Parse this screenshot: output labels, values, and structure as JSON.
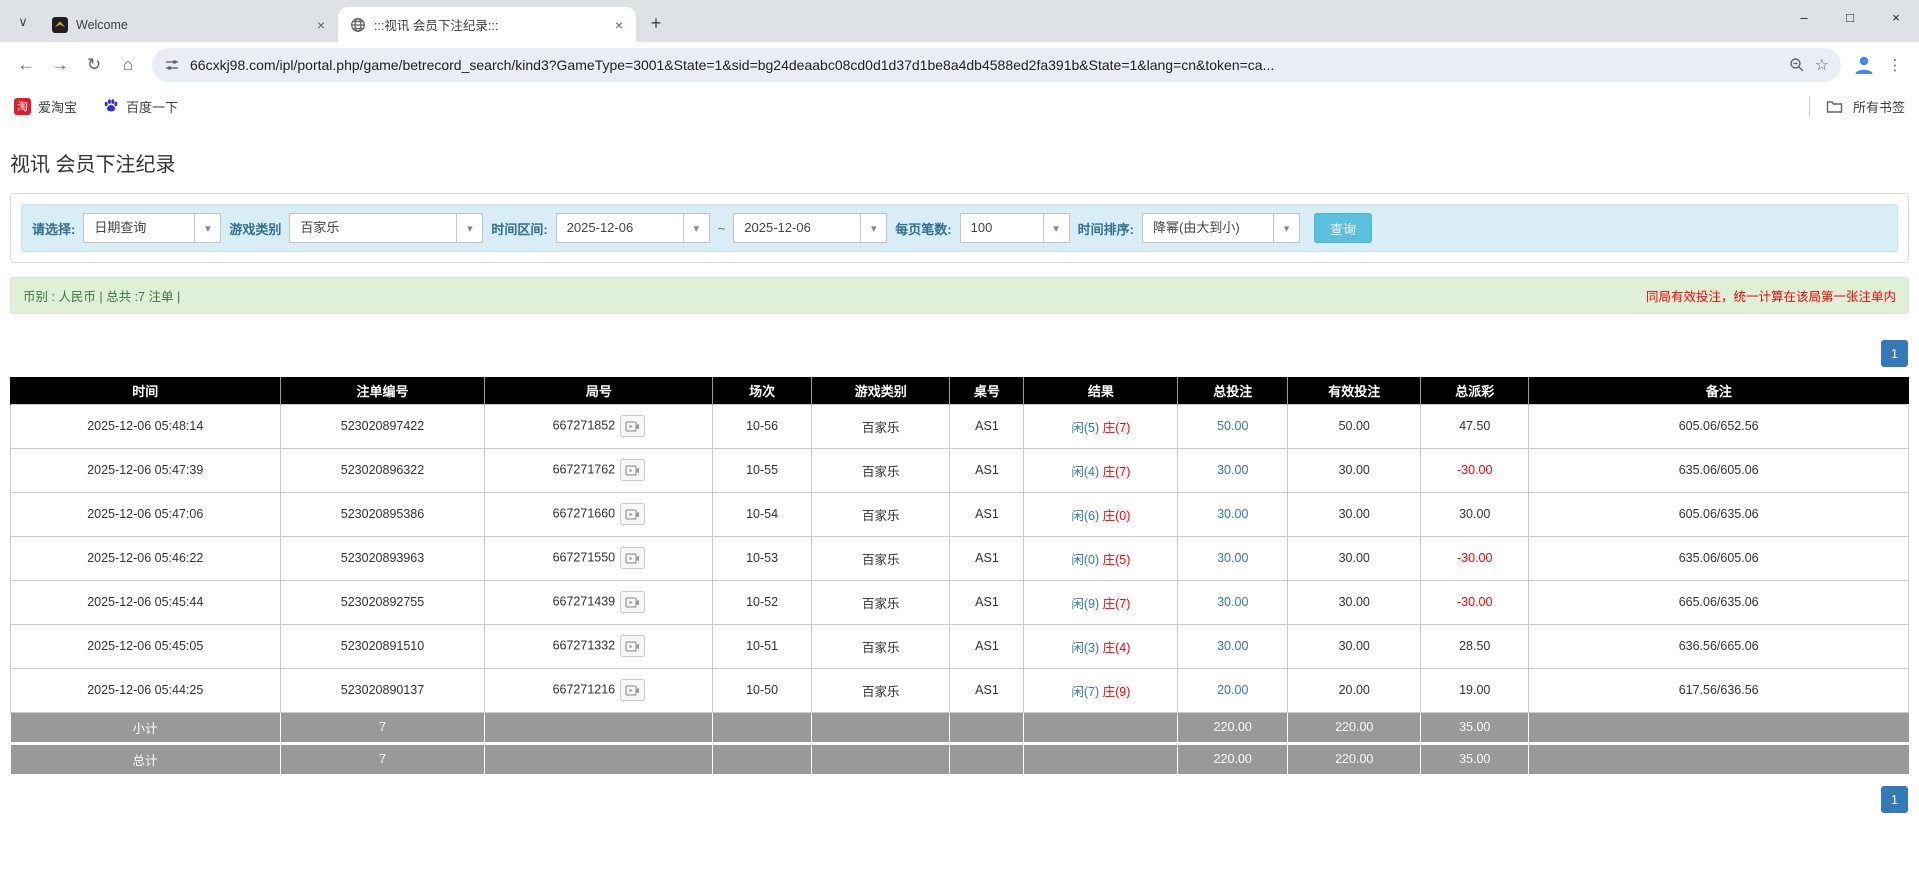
{
  "browser": {
    "tabs": [
      {
        "title": "Welcome"
      },
      {
        "title": ":::视讯 会员下注纪录:::"
      }
    ],
    "url": "66cxkj98.com/ipl/portal.php/game/betrecord_search/kind3?GameType=3001&State=1&sid=bg24deaabc08cd0d1d37d1be8a4db4588ed2fa391b&State=1&lang=cn&token=ca...",
    "bookmarks": [
      {
        "label": "爱淘宝",
        "icon_label": "淘"
      },
      {
        "label": "百度一下"
      }
    ],
    "all_bookmarks_label": "所有书签"
  },
  "icons": {
    "tab_chevron": "∨",
    "close": "×",
    "plus": "+",
    "minimize": "–",
    "maximize": "□",
    "back": "←",
    "forward": "→",
    "reload": "↻",
    "home": "⌂",
    "star": "☆",
    "menu": "⋮",
    "arrow_down": "▾"
  },
  "page": {
    "title": "视讯 会员下注纪录",
    "filters": {
      "select_label": "请选择:",
      "select_value": "日期查询",
      "game_type_label": "游戏类别",
      "game_type_value": "百家乐",
      "range_label": "时间区间:",
      "date_from": "2025-12-06",
      "range_separator": "~",
      "date_to": "2025-12-06",
      "page_size_label": "每页笔数:",
      "page_size_value": "100",
      "sort_label": "时间排序:",
      "sort_value": "降幂(由大到小)",
      "search_label": "查询"
    },
    "summary": {
      "left": "币别 : 人民币 | 总共 :7 注单 |",
      "right": "同局有效投注，统一计算在该局第一张注单内"
    },
    "pagination": {
      "page": "1"
    },
    "table": {
      "headers": [
        "时间",
        "注单编号",
        "局号",
        "场次",
        "游戏类别",
        "桌号",
        "结果",
        "总投注",
        "有效投注",
        "总派彩",
        "备注"
      ],
      "rows": [
        {
          "time": "2025-12-06 05:48:14",
          "bet_id": "523020897422",
          "round_id": "667271852",
          "session": "10-56",
          "game": "百家乐",
          "table_no": "AS1",
          "result_player": "闲(5)",
          "result_banker": "庄(7)",
          "total_bet": "50.00",
          "valid_bet": "50.00",
          "payout": "47.50",
          "note": "605.06/652.56"
        },
        {
          "time": "2025-12-06 05:47:39",
          "bet_id": "523020896322",
          "round_id": "667271762",
          "session": "10-55",
          "game": "百家乐",
          "table_no": "AS1",
          "result_player": "闲(4)",
          "result_banker": "庄(7)",
          "total_bet": "30.00",
          "valid_bet": "30.00",
          "payout": "-30.00",
          "note": "635.06/605.06"
        },
        {
          "time": "2025-12-06 05:47:06",
          "bet_id": "523020895386",
          "round_id": "667271660",
          "session": "10-54",
          "game": "百家乐",
          "table_no": "AS1",
          "result_player": "闲(6)",
          "result_banker": "庄(0)",
          "total_bet": "30.00",
          "valid_bet": "30.00",
          "payout": "30.00",
          "note": "605.06/635.06"
        },
        {
          "time": "2025-12-06 05:46:22",
          "bet_id": "523020893963",
          "round_id": "667271550",
          "session": "10-53",
          "game": "百家乐",
          "table_no": "AS1",
          "result_player": "闲(0)",
          "result_banker": "庄(5)",
          "total_bet": "30.00",
          "valid_bet": "30.00",
          "payout": "-30.00",
          "note": "635.06/605.06"
        },
        {
          "time": "2025-12-06 05:45:44",
          "bet_id": "523020892755",
          "round_id": "667271439",
          "session": "10-52",
          "game": "百家乐",
          "table_no": "AS1",
          "result_player": "闲(9)",
          "result_banker": "庄(7)",
          "total_bet": "30.00",
          "valid_bet": "30.00",
          "payout": "-30.00",
          "note": "665.06/635.06"
        },
        {
          "time": "2025-12-06 05:45:05",
          "bet_id": "523020891510",
          "round_id": "667271332",
          "session": "10-51",
          "game": "百家乐",
          "table_no": "AS1",
          "result_player": "闲(3)",
          "result_banker": "庄(4)",
          "total_bet": "30.00",
          "valid_bet": "30.00",
          "payout": "28.50",
          "note": "636.56/665.06"
        },
        {
          "time": "2025-12-06 05:44:25",
          "bet_id": "523020890137",
          "round_id": "667271216",
          "session": "10-50",
          "game": "百家乐",
          "table_no": "AS1",
          "result_player": "闲(7)",
          "result_banker": "庄(9)",
          "total_bet": "20.00",
          "valid_bet": "20.00",
          "payout": "19.00",
          "note": "617.56/636.56"
        }
      ],
      "subtotal": {
        "label": "小计",
        "count": "7",
        "total_bet": "220.00",
        "valid_bet": "220.00",
        "payout": "35.00"
      },
      "total": {
        "label": "总计",
        "count": "7",
        "total_bet": "220.00",
        "valid_bet": "220.00",
        "payout": "35.00"
      }
    },
    "colors": {
      "header_bg": "#000000",
      "footer_bg": "#999999",
      "filter_bg": "#d9edf7",
      "filter_label": "#31708f",
      "summary_bg": "#dff0d8",
      "summary_text": "#3c763d",
      "notice_red": "#ff0000",
      "link_blue": "#337ab7",
      "negative_red": "#ff0000",
      "search_button": "#5bc0de",
      "pagination_blue": "#337ab7"
    }
  }
}
